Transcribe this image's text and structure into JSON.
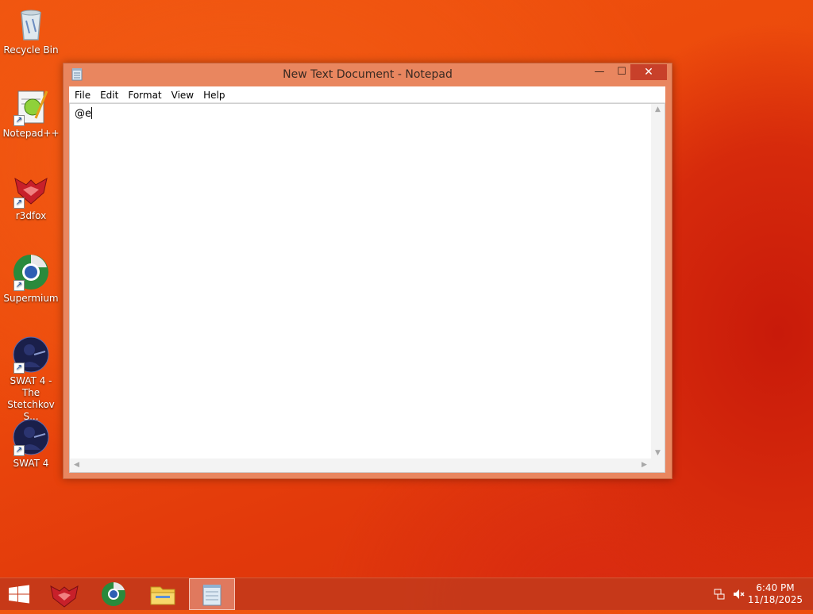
{
  "desktop": {
    "icons": [
      {
        "label": "Recycle Bin",
        "icon": "recycle-bin-icon"
      },
      {
        "label": "Notepad++",
        "icon": "notepad-plus-plus-icon"
      },
      {
        "label": "r3dfox",
        "icon": "r3dfox-icon"
      },
      {
        "label": "Supermium",
        "icon": "supermium-icon"
      },
      {
        "label": "SWAT 4 - The Stetchkov S...",
        "icon": "swat4-expansion-icon"
      },
      {
        "label": "SWAT 4",
        "icon": "swat4-icon"
      }
    ]
  },
  "window": {
    "title": "New Text Document - Notepad",
    "controls": {
      "minimize": "—",
      "maximize": "☐",
      "close": "✕"
    },
    "menu": [
      "File",
      "Edit",
      "Format",
      "View",
      "Help"
    ],
    "content": "@e"
  },
  "taskbar": {
    "apps": [
      "start-icon",
      "r3dfox-icon",
      "supermium-icon",
      "file-explorer-icon",
      "notepad-icon"
    ],
    "active_app": "notepad",
    "time": "6:40 PM",
    "date": "11/18/2025"
  },
  "colors": {
    "accent": "#e9865f",
    "close_button": "#c8402a",
    "desktop_background": "#ec4a0c",
    "taskbar": "#c43a1a"
  }
}
